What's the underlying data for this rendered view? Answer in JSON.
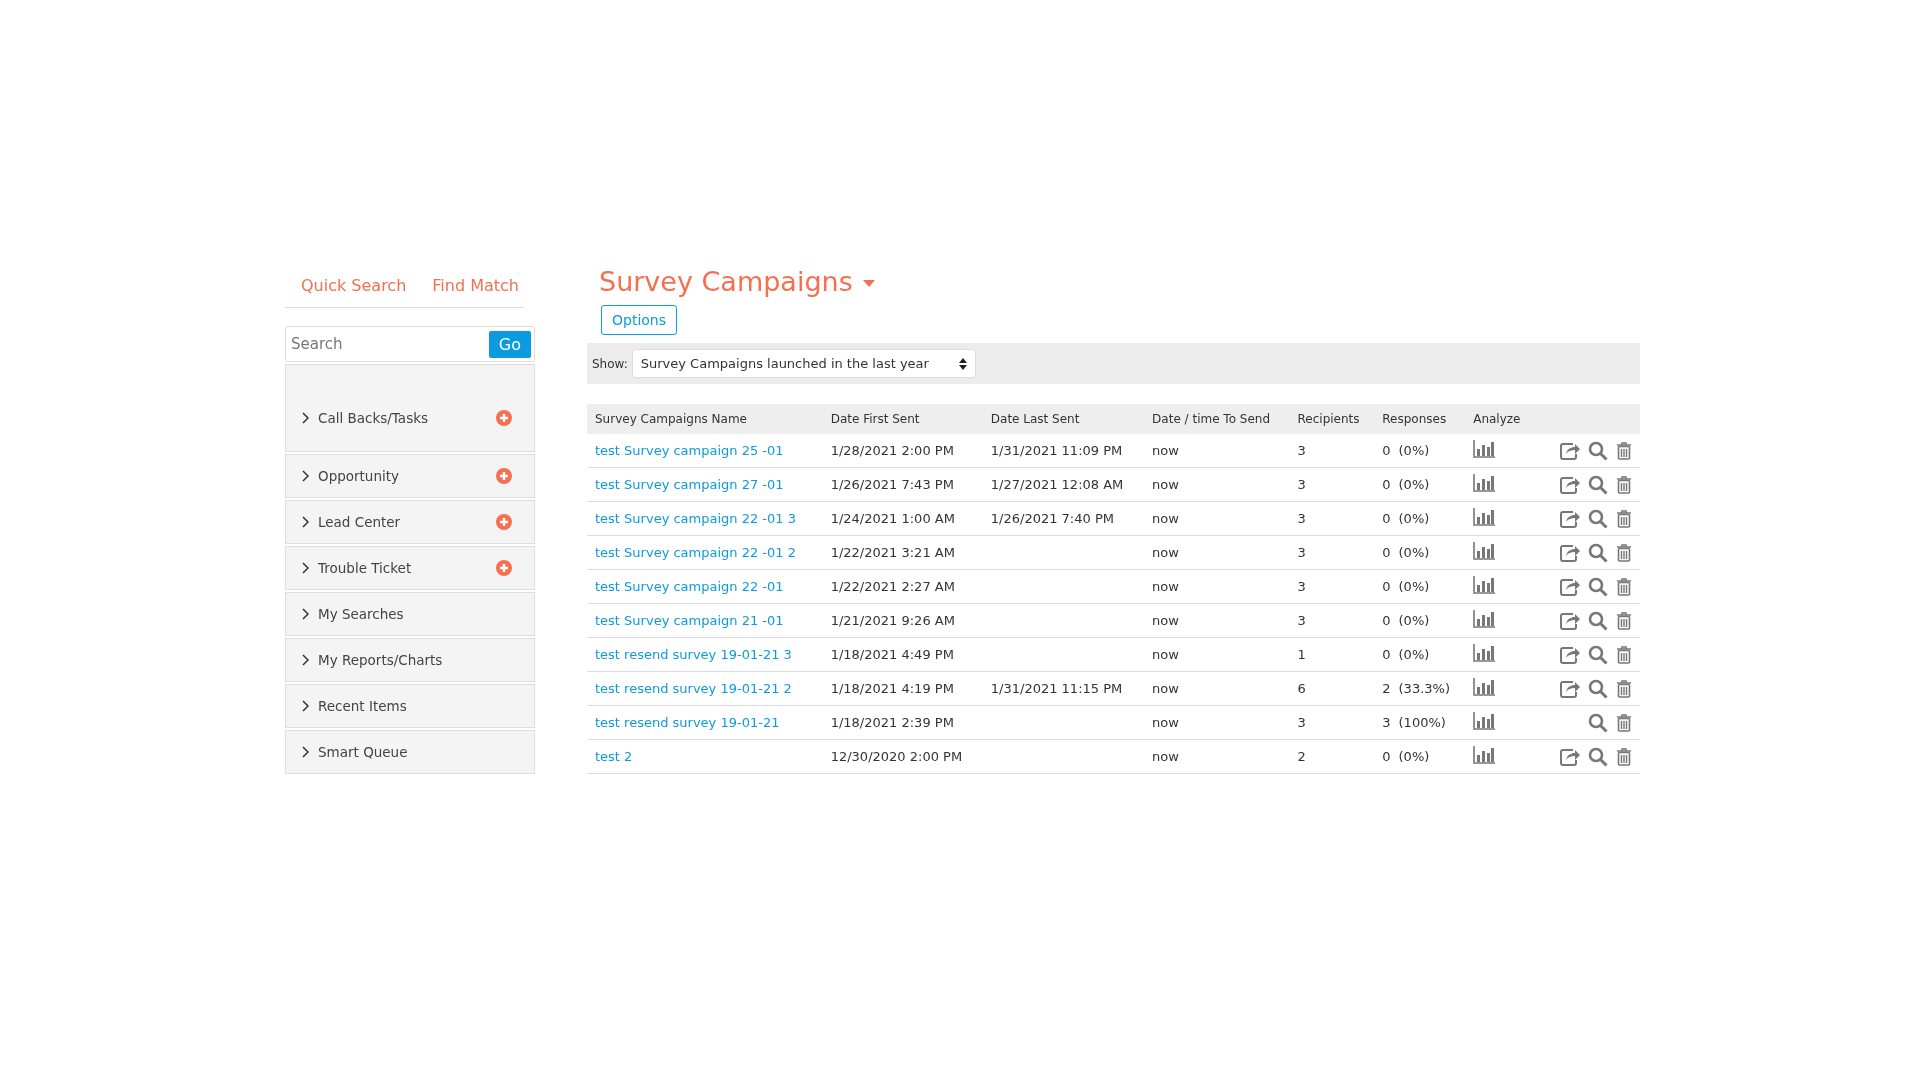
{
  "tabs": [
    {
      "label": "Quick Search"
    },
    {
      "label": "Find Match"
    }
  ],
  "search": {
    "placeholder": "Search",
    "button": "Go"
  },
  "sidebar": {
    "items": [
      {
        "label": "Call Backs/Tasks",
        "addable": true
      },
      {
        "label": "Opportunity",
        "addable": true
      },
      {
        "label": "Lead Center",
        "addable": true
      },
      {
        "label": "Trouble Ticket",
        "addable": true
      },
      {
        "label": "My Searches",
        "addable": false
      },
      {
        "label": "My Reports/Charts",
        "addable": false
      },
      {
        "label": "Recent Items",
        "addable": false
      },
      {
        "label": "Smart Queue",
        "addable": false
      }
    ]
  },
  "page_title": "Survey Campaigns",
  "options_button": "Options",
  "filter": {
    "label": "Show:",
    "value": "Survey Campaigns launched in the last year"
  },
  "table": {
    "columns": [
      "Survey Campaigns Name",
      "Date First Sent",
      "Date Last Sent",
      "Date / time To Send",
      "Recipients",
      "Responses",
      "Analyze"
    ],
    "rows": [
      {
        "name": "test Survey campaign 25 -01",
        "first": "1/28/2021 2:00 PM",
        "last": "1/31/2021 11:09 PM",
        "send": "now",
        "recipients": "3",
        "responses": "0",
        "percent": "(0%)",
        "shareable": true
      },
      {
        "name": "test Survey campaign 27 -01",
        "first": "1/26/2021 7:43 PM",
        "last": "1/27/2021 12:08 AM",
        "send": "now",
        "recipients": "3",
        "responses": "0",
        "percent": "(0%)",
        "shareable": true
      },
      {
        "name": "test Survey campaign 22 -01 3",
        "first": "1/24/2021 1:00 AM",
        "last": "1/26/2021 7:40 PM",
        "send": "now",
        "recipients": "3",
        "responses": "0",
        "percent": "(0%)",
        "shareable": true
      },
      {
        "name": "test Survey campaign 22 -01 2",
        "first": "1/22/2021 3:21 AM",
        "last": "",
        "send": "now",
        "recipients": "3",
        "responses": "0",
        "percent": "(0%)",
        "shareable": true
      },
      {
        "name": "test Survey campaign 22 -01",
        "first": "1/22/2021 2:27 AM",
        "last": "",
        "send": "now",
        "recipients": "3",
        "responses": "0",
        "percent": "(0%)",
        "shareable": true
      },
      {
        "name": "test Survey campaign 21 -01",
        "first": "1/21/2021 9:26 AM",
        "last": "",
        "send": "now",
        "recipients": "3",
        "responses": "0",
        "percent": "(0%)",
        "shareable": true
      },
      {
        "name": "test resend survey 19-01-21 3",
        "first": "1/18/2021 4:49 PM",
        "last": "",
        "send": "now",
        "recipients": "1",
        "responses": "0",
        "percent": "(0%)",
        "shareable": true
      },
      {
        "name": "test resend survey 19-01-21 2",
        "first": "1/18/2021 4:19 PM",
        "last": "1/31/2021 11:15 PM",
        "send": "now",
        "recipients": "6",
        "responses": "2",
        "percent": "(33.3%)",
        "shareable": true
      },
      {
        "name": "test resend survey 19-01-21",
        "first": "1/18/2021 2:39 PM",
        "last": "",
        "send": "now",
        "recipients": "3",
        "responses": "3",
        "percent": "(100%)",
        "shareable": false
      },
      {
        "name": "test 2",
        "first": "12/30/2020 2:00 PM",
        "last": "",
        "send": "now",
        "recipients": "2",
        "responses": "0",
        "percent": "(0%)",
        "shareable": true
      }
    ]
  }
}
